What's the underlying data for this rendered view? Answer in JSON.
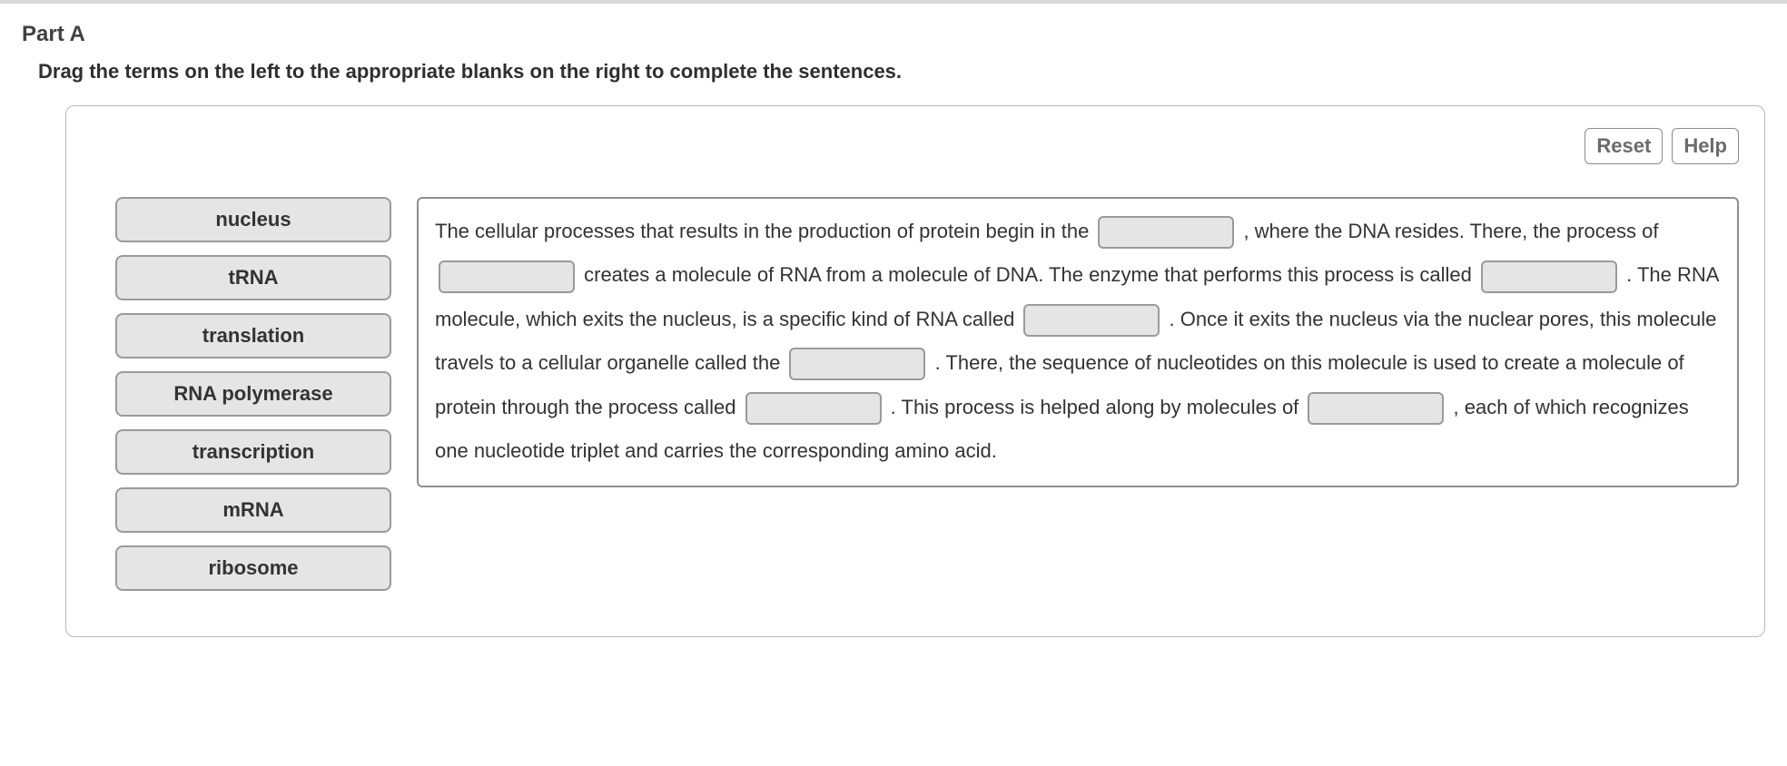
{
  "header": {
    "part_label": "Part A",
    "instructions": "Drag the terms on the left to the appropriate blanks on the right to complete the sentences."
  },
  "toolbar": {
    "reset_label": "Reset",
    "help_label": "Help"
  },
  "terms": [
    "nucleus",
    "tRNA",
    "translation",
    "RNA polymerase",
    "transcription",
    "mRNA",
    "ribosome"
  ],
  "sentence": {
    "seg0": "The cellular processes that results in the production of protein begin in the ",
    "seg1": " , where the DNA resides. There, the process of ",
    "seg2": " creates a molecule of RNA from a molecule of DNA. The enzyme that performs this process is called ",
    "seg3": " . The RNA molecule, which exits the nucleus, is a specific kind of RNA called ",
    "seg4": " . Once it exits the nucleus via the nuclear pores, this molecule travels to a cellular organelle called the ",
    "seg5": " . There, the sequence of nucleotides on this molecule is used to create a molecule of protein through the process called ",
    "seg6": " . This process is helped along by molecules of ",
    "seg7": " , each of which recognizes one nucleotide triplet and carries the corresponding amino acid."
  }
}
